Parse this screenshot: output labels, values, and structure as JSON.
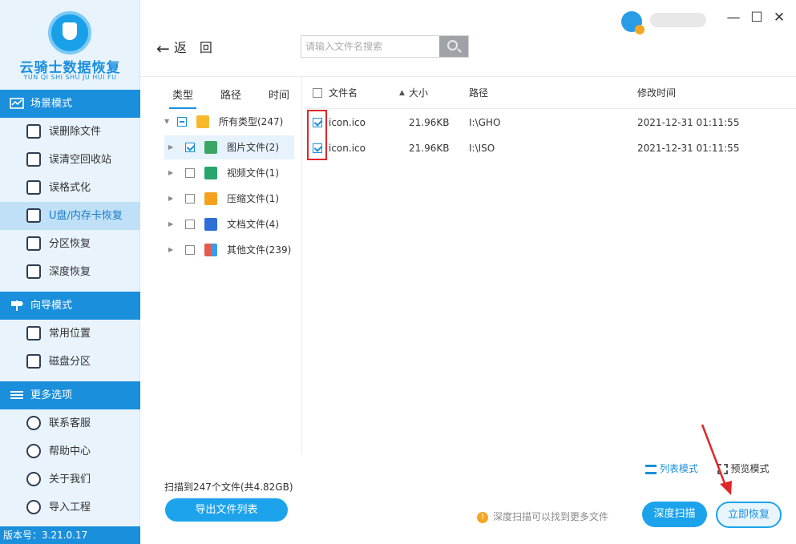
{
  "app": {
    "title": "云骑士数据恢复",
    "subtitle": "YUN QI SHI SHU JU HUI FU",
    "version": "版本号：3.21.0.17"
  },
  "sidebar": {
    "sections": [
      {
        "label": "场景模式",
        "icon": "scene-icon",
        "items": [
          {
            "label": "误删除文件",
            "icon": "deleted-file-icon"
          },
          {
            "label": "误清空回收站",
            "icon": "recycle-bin-icon"
          },
          {
            "label": "误格式化",
            "icon": "format-icon"
          },
          {
            "label": "U盘/内存卡恢复",
            "icon": "usb-card-icon",
            "active": true
          },
          {
            "label": "分区恢复",
            "icon": "partition-icon"
          },
          {
            "label": "深度恢复",
            "icon": "deep-recovery-icon"
          }
        ]
      },
      {
        "label": "向导模式",
        "icon": "guide-icon",
        "items": [
          {
            "label": "常用位置",
            "icon": "common-location-icon"
          },
          {
            "label": "磁盘分区",
            "icon": "disk-partition-icon"
          }
        ]
      },
      {
        "label": "更多选项",
        "icon": "menu-icon",
        "items": [
          {
            "label": "联系客服",
            "icon": "customer-service-icon"
          },
          {
            "label": "帮助中心",
            "icon": "help-icon"
          },
          {
            "label": "关于我们",
            "icon": "about-icon"
          },
          {
            "label": "导入工程",
            "icon": "import-project-icon"
          }
        ]
      }
    ]
  },
  "header": {
    "back_label": "返　回",
    "search_placeholder": "请输入文件名搜索",
    "window_controls": [
      "—",
      "☐",
      "✕"
    ]
  },
  "type_panel": {
    "tabs": [
      "类型",
      "路径",
      "时间"
    ],
    "active_tab": "类型",
    "tree": [
      {
        "label": "所有类型(247)",
        "icon": "folder-icon",
        "state": "partial",
        "color": "#f7b92c",
        "root": true
      },
      {
        "label": "图片文件(2)",
        "icon": "image-icon",
        "state": "checked",
        "color": "#3aa564",
        "selected": true
      },
      {
        "label": "视频文件(1)",
        "icon": "video-icon",
        "state": "unchecked",
        "color": "#27a56b"
      },
      {
        "label": "压缩文件(1)",
        "icon": "archive-icon",
        "state": "unchecked",
        "color": "#f4a21d"
      },
      {
        "label": "文档文件(4)",
        "icon": "document-icon",
        "state": "unchecked",
        "color": "#2d6fd6"
      },
      {
        "label": "其他文件(239)",
        "icon": "other-files-icon",
        "state": "unchecked",
        "color": "#e9594b"
      }
    ]
  },
  "file_list": {
    "columns": {
      "name": "文件名",
      "size": "大小",
      "path": "路径",
      "modified": "修改时间"
    },
    "rows": [
      {
        "name": "icon.ico",
        "size": "21.96KB",
        "path": "I:\\GHO",
        "modified": "2021-12-31 01:11:55",
        "checked": true
      },
      {
        "name": "icon.ico",
        "size": "21.96KB",
        "path": "I:\\ISO",
        "modified": "2021-12-31 01:11:55",
        "checked": true
      }
    ]
  },
  "footer": {
    "list_mode": "列表模式",
    "preview_mode": "预览模式",
    "scan_summary": "扫描到247个文件(共4.82GB)",
    "export_button": "导出文件列表",
    "tip": "深度扫描可以找到更多文件",
    "deep_scan_button": "深度扫描",
    "recover_button": "立即恢复"
  },
  "colors": {
    "accent": "#1a8fdc",
    "button": "#1ca3ec",
    "annotation": "#e0262a"
  }
}
